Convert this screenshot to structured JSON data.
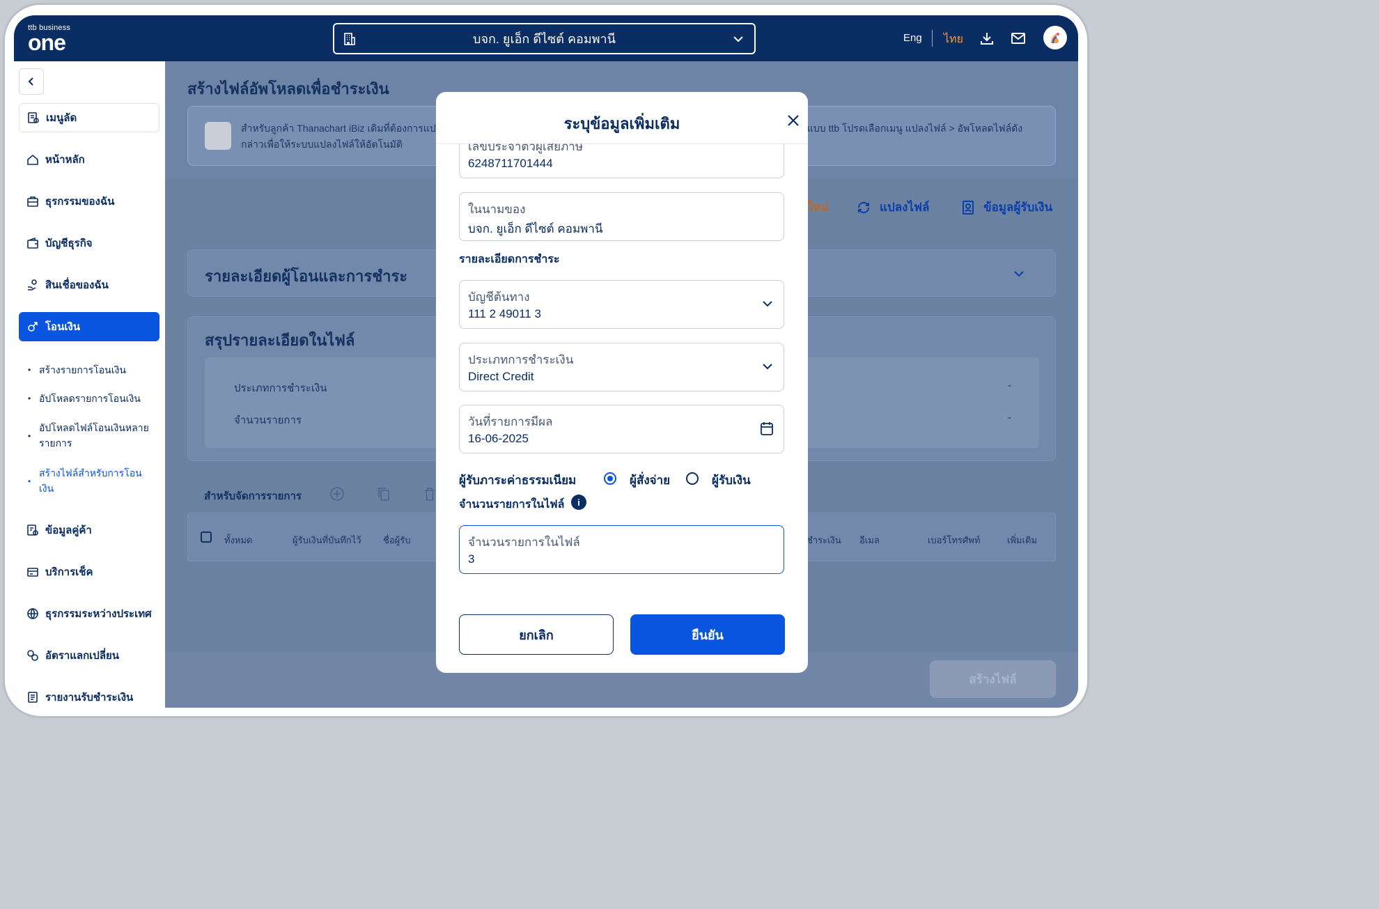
{
  "header": {
    "logo_small": "ttb business",
    "logo_big": "one",
    "company": "บจก. ยูเอ็ก ดีไซต์ คอมพานี",
    "lang_eng": "Eng",
    "lang_thai": "ไทย"
  },
  "sidebar": {
    "shortcut": "เมนูลัด",
    "items": [
      {
        "label": "หน้าหลัก",
        "icon": "home-icon"
      },
      {
        "label": "ธุรกรรมของฉัน",
        "icon": "briefcase-icon"
      },
      {
        "label": "บัญชีธุรกิจ",
        "icon": "wallet-icon"
      },
      {
        "label": "สินเชื่อของฉัน",
        "icon": "loan-icon"
      },
      {
        "label": "โอนเงิน",
        "icon": "transfer-icon",
        "active": true
      },
      {
        "label": "ข้อมูลคู่ค้า",
        "icon": "partner-icon"
      },
      {
        "label": "บริการเช็ค",
        "icon": "cheque-icon"
      },
      {
        "label": "ธุรกรรมระหว่างประเทศ",
        "icon": "globe-icon"
      },
      {
        "label": "อัตราแลกเปลี่ยน",
        "icon": "exchange-icon"
      },
      {
        "label": "รายงานรับชำระเงิน",
        "icon": "report-icon"
      }
    ],
    "sub_items": [
      "สร้างรายการโอนเงิน",
      "อัปโหลดรายการโอนเงิน",
      "อัปโหลดไฟล์โอนเงินหลายรายการ",
      "สร้างไฟล์สำหรับการโอนเงิน"
    ]
  },
  "page": {
    "title": "สร้างไฟล์อัพโหลดเพื่อชำระเงิน",
    "banner_line1": "สำหรับลูกค้า Thanachart iBiz เดิมที่ต้องการแป",
    "banner_line2": "กล่าวเพื่อให้ระบบแปลงไฟล์ให้อัตโนมัติ",
    "banner_right": "ปแบบ ttb โปรดเลือกเมนู แปลงไฟล์ > อัพโหลดไฟล์ดัง",
    "action_new": "ใหม่",
    "action_convert": "แปลงไฟล์",
    "action_payee": "ข้อมูลผู้รับเงิน",
    "section_payer": "รายละเอียดผู้โอนและการชำระ",
    "section_summary": "สรุปรายละเอียดในไฟล์",
    "summary_row1": "ประเภทการชำระเงิน",
    "summary_row2": "จำนวนรายการ",
    "dash": "-",
    "manage_label": "สำหรับจัดการรายการ",
    "table_cols": [
      "ทั้งหมด",
      "ผู้รับเงินที่บันทึกไว้",
      "ชื่อผู้รับ",
      "ชำระเงิน",
      "อีเมล",
      "เบอร์โทรศัพท์",
      "เพิ่มเติม"
    ],
    "create_file": "สร้างไฟล์"
  },
  "modal": {
    "title": "ระบุข้อมูลเพิ่มเติม",
    "tax_label": "เลขประจำตัวผู้เสียภาษี",
    "tax_value": "6248711701444",
    "name_label": "ในนามของ",
    "name_value": "บจก. ยูเอ็ก ดีไซต์ คอมพานี",
    "payment_section": "รายละเอียดการชำระ",
    "source_label": "บัญชีต้นทาง",
    "source_value": "111 2 49011 3",
    "type_label": "ประเภทการชำระเงิน",
    "type_value": "Direct Credit",
    "date_label": "วันที่รายการมีผล",
    "date_value": "16-06-2025",
    "fee_label": "ผู้รับภาระค่าธรรมเนียม",
    "fee_option1": "ผู้สั่งจ่าย",
    "fee_option2": "ผู้รับเงิน",
    "fee_selected": "ผู้สั่งจ่าย",
    "count_section": "จำนวนรายการในไฟล์",
    "count_label": "จำนวนรายการในไฟล์",
    "count_value": "3",
    "cancel": "ยกเลิก",
    "confirm": "ยืนยัน"
  },
  "colors": {
    "navy": "#0a2d63",
    "accent": "#0a55e0",
    "thai_lang": "#f39a4a"
  }
}
